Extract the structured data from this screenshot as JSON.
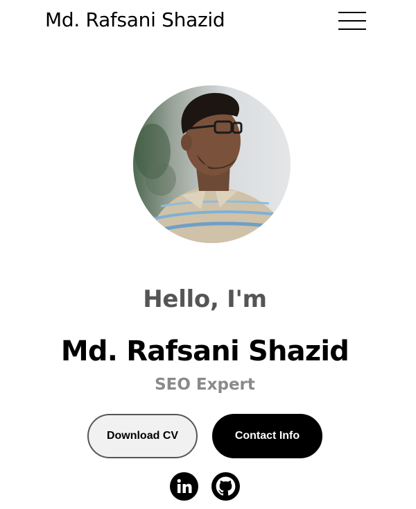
{
  "nav": {
    "logo_text": "Md. Rafsani Shazid",
    "menu_icon": "hamburger-menu-icon"
  },
  "hero": {
    "greeting": "Hello, I'm",
    "name": "Md. Rafsani Shazid",
    "role": "SEO Expert",
    "profile_image": "profile-photo"
  },
  "buttons": {
    "download_cv": "Download CV",
    "contact_info": "Contact Info"
  },
  "social": {
    "icons": [
      "linkedin-icon",
      "github-icon"
    ]
  },
  "colors": {
    "background": "#ffffff",
    "text_primary": "#000000",
    "text_greeting": "#555555",
    "text_role": "#8a8a8a",
    "button_secondary_bg": "#f1f1f1",
    "button_primary_bg": "#000000"
  }
}
